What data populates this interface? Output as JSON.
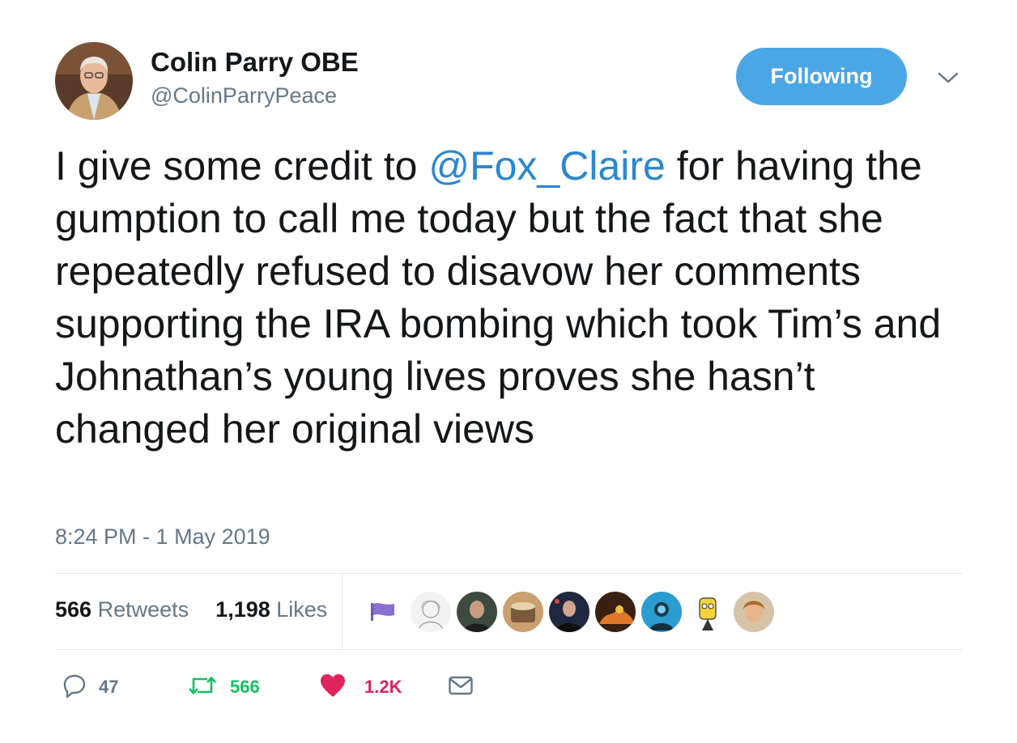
{
  "header": {
    "display_name": "Colin Parry OBE",
    "handle": "@ColinParryPeace",
    "follow_label": "Following",
    "avatar_icon": "avatar-photo",
    "caret_icon": "chevron-down-icon"
  },
  "tweet": {
    "text_before": "I give some credit to ",
    "mention": "@Fox_Claire",
    "text_after": " for having the gumption to call me today but the fact that she repeatedly refused to disavow her comments supporting the IRA bombing which took Tim’s and Johnathan’s young lives proves she hasn’t changed her original views",
    "timestamp": "8:24 PM - 1 May 2019"
  },
  "stats": {
    "retweets_count": "566",
    "retweets_label": "Retweets",
    "likes_count": "1,198",
    "likes_label": "Likes"
  },
  "actions": {
    "reply_count": "47",
    "retweet_count": "566",
    "like_count": "1.2K"
  },
  "colors": {
    "accent": "#4ba6e6",
    "mention": "#2b87cf",
    "retweet_green": "#17bf63",
    "like_red": "#e0245e",
    "muted": "#657786"
  }
}
